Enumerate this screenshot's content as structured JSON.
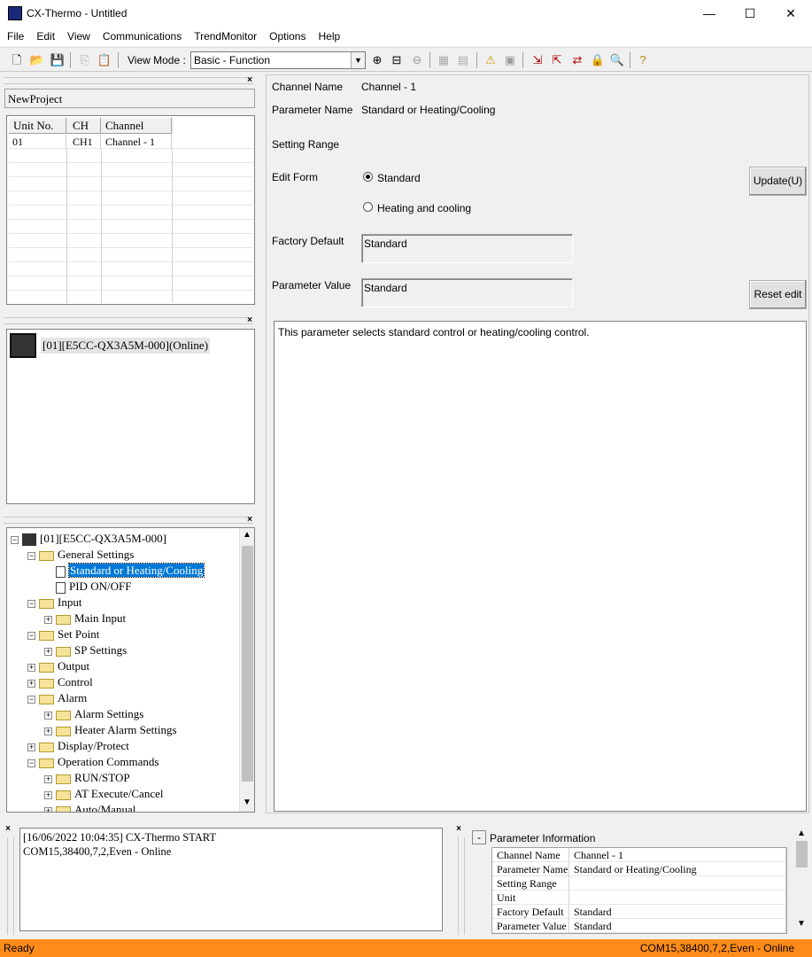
{
  "window": {
    "title": "CX-Thermo - Untitled",
    "minimize": "—",
    "maximize": "☐",
    "close": "✕"
  },
  "menu": [
    "File",
    "Edit",
    "View",
    "Communications",
    "TrendMonitor",
    "Options",
    "Help"
  ],
  "toolbar": {
    "viewmode_label": "View Mode :",
    "viewmode_value": "Basic - Function"
  },
  "project": {
    "name": "NewProject",
    "columns": [
      "Unit No.",
      "CH",
      "Channel name"
    ],
    "rows": [
      [
        "01",
        "CH1",
        "Channel - 1"
      ]
    ]
  },
  "device": {
    "label": "[01][E5CC-QX3A5M-000](Online)"
  },
  "tree": {
    "root": "[01][E5CC-QX3A5M-000]",
    "items": [
      {
        "label": "General Settings",
        "level": 1,
        "type": "folder",
        "sign": "−"
      },
      {
        "label": "Standard or Heating/Cooling",
        "level": 2,
        "type": "doc",
        "sign": ""
      },
      {
        "label": "PID ON/OFF",
        "level": 2,
        "type": "doc",
        "sign": ""
      },
      {
        "label": "Input",
        "level": 1,
        "type": "folder",
        "sign": "−"
      },
      {
        "label": "Main Input",
        "level": 2,
        "type": "folder",
        "sign": "+"
      },
      {
        "label": "Set Point",
        "level": 1,
        "type": "folder",
        "sign": "−"
      },
      {
        "label": "SP Settings",
        "level": 2,
        "type": "folder",
        "sign": "+"
      },
      {
        "label": "Output",
        "level": 1,
        "type": "folder",
        "sign": "+"
      },
      {
        "label": "Control",
        "level": 1,
        "type": "folder",
        "sign": "+"
      },
      {
        "label": "Alarm",
        "level": 1,
        "type": "folder",
        "sign": "−"
      },
      {
        "label": "Alarm Settings",
        "level": 2,
        "type": "folder",
        "sign": "+"
      },
      {
        "label": "Heater Alarm Settings",
        "level": 2,
        "type": "folder",
        "sign": "+"
      },
      {
        "label": "Display/Protect",
        "level": 1,
        "type": "folder",
        "sign": "+"
      },
      {
        "label": "Operation Commands",
        "level": 1,
        "type": "folder",
        "sign": "−"
      },
      {
        "label": "RUN/STOP",
        "level": 2,
        "type": "folder",
        "sign": "+"
      },
      {
        "label": "AT Execute/Cancel",
        "level": 2,
        "type": "folder",
        "sign": "+"
      },
      {
        "label": "Auto/Manual",
        "level": 2,
        "type": "folder",
        "sign": "+"
      }
    ]
  },
  "detail": {
    "channel_name_label": "Channel Name",
    "channel_name_value": "Channel - 1",
    "param_name_label": "Parameter Name",
    "param_name_value": "Standard or Heating/Cooling",
    "setting_range_label": "Setting Range",
    "edit_form_label": "Edit Form",
    "option_standard": "Standard",
    "option_heating": "Heating and cooling",
    "factory_default_label": "Factory Default",
    "factory_default_value": "Standard",
    "param_value_label": "Parameter Value",
    "param_value_value": "Standard",
    "update_button": "Update(U)",
    "reset_button": "Reset edit",
    "description": "This parameter selects standard control or heating/cooling control."
  },
  "log": [
    "[16/06/2022 10:04:35] CX-Thermo START",
    "COM15,38400,7,2,Even - Online"
  ],
  "param_info": {
    "title": "Parameter Information",
    "collapse": "-",
    "rows": [
      [
        "Channel Name",
        "Channel - 1"
      ],
      [
        "Parameter Name",
        "Standard or Heating/Cooling"
      ],
      [
        "Setting Range",
        ""
      ],
      [
        "Unit",
        ""
      ],
      [
        "Factory Default",
        "Standard"
      ],
      [
        "Parameter Value",
        "Standard"
      ]
    ]
  },
  "status": {
    "left": "Ready",
    "right": "COM15,38400,7,2,Even - Online"
  },
  "colors": {
    "status_bar": "#ff8c1a",
    "selection": "#0078d7"
  }
}
